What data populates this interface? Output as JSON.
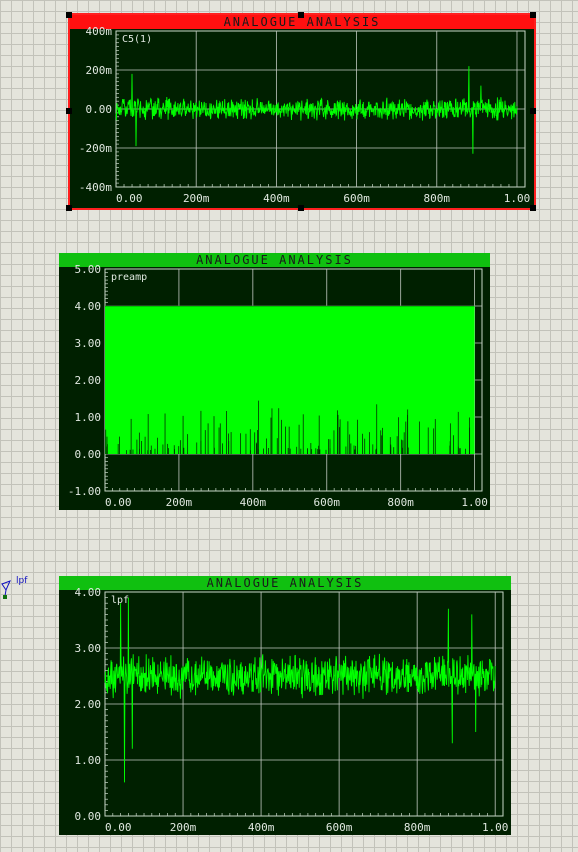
{
  "probe": {
    "label": "lpf"
  },
  "graphs": [
    {
      "title": "ANALOGUE ANALYSIS",
      "trace_label": "C5(1)",
      "title_bg": "#ff1010",
      "selected": true,
      "chart_data": {
        "type": "line",
        "series": [
          {
            "name": "C5(1)",
            "color": "#00ff00"
          }
        ],
        "x_ticks": [
          "0.00",
          "200m",
          "400m",
          "600m",
          "800m",
          "1.00"
        ],
        "y_ticks": [
          "400m",
          "200m",
          "0.00",
          "-200m",
          "-400m"
        ],
        "xlim": [
          0,
          1.02
        ],
        "ylim": [
          -400,
          400
        ],
        "y_units": "m",
        "signal": {
          "kind": "noise",
          "center": 0,
          "amplitude": 45,
          "spikes": [
            [
              0.04,
              180
            ],
            [
              0.05,
              -190
            ],
            [
              0.88,
              220
            ],
            [
              0.89,
              -230
            ],
            [
              0.91,
              120
            ]
          ]
        },
        "grid": true
      }
    },
    {
      "title": "ANALOGUE ANALYSIS",
      "trace_label": "preamp",
      "title_bg": "#10c010",
      "selected": false,
      "chart_data": {
        "type": "area",
        "series": [
          {
            "name": "preamp",
            "color": "#00ff00"
          }
        ],
        "x_ticks": [
          "0.00",
          "200m",
          "400m",
          "600m",
          "800m",
          "1.00"
        ],
        "y_ticks": [
          "5.00",
          "4.00",
          "3.00",
          "2.00",
          "1.00",
          "0.00",
          "-1.00"
        ],
        "xlim": [
          0,
          1.02
        ],
        "ylim": [
          -1,
          5
        ],
        "signal": {
          "kind": "square",
          "high": 4.0,
          "low": 0.0
        },
        "grid": true
      }
    },
    {
      "title": "ANALOGUE ANALYSIS",
      "trace_label": "lpf",
      "title_bg": "#10c010",
      "selected": false,
      "chart_data": {
        "type": "line",
        "series": [
          {
            "name": "lpf",
            "color": "#00ff00"
          }
        ],
        "x_ticks": [
          "0.00",
          "200m",
          "400m",
          "600m",
          "800m",
          "1.00"
        ],
        "y_ticks": [
          "4.00",
          "3.00",
          "2.00",
          "1.00",
          "0.00"
        ],
        "xlim": [
          0,
          1.02
        ],
        "ylim": [
          0,
          4
        ],
        "signal": {
          "kind": "noise",
          "center": 2.5,
          "amplitude": 0.3,
          "spikes": [
            [
              0.04,
              3.8
            ],
            [
              0.05,
              0.6
            ],
            [
              0.06,
              3.9
            ],
            [
              0.07,
              1.2
            ],
            [
              0.88,
              3.7
            ],
            [
              0.89,
              1.3
            ],
            [
              0.94,
              3.6
            ],
            [
              0.95,
              1.5
            ]
          ]
        },
        "grid": true
      }
    }
  ]
}
